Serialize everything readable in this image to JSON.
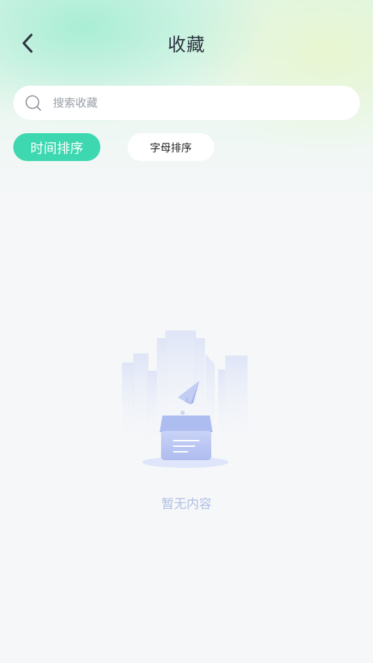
{
  "header": {
    "title": "收藏",
    "back_icon": "chevron-left-icon"
  },
  "search": {
    "placeholder": "搜索收藏",
    "value": "",
    "icon": "search-icon"
  },
  "sort": {
    "options": [
      {
        "label": "时间排序",
        "active": true
      },
      {
        "label": "字母排序",
        "active": false
      }
    ],
    "active_color": "#3ed8b0"
  },
  "empty_state": {
    "text": "暂无内容",
    "illustration": "empty-box-illustration"
  }
}
